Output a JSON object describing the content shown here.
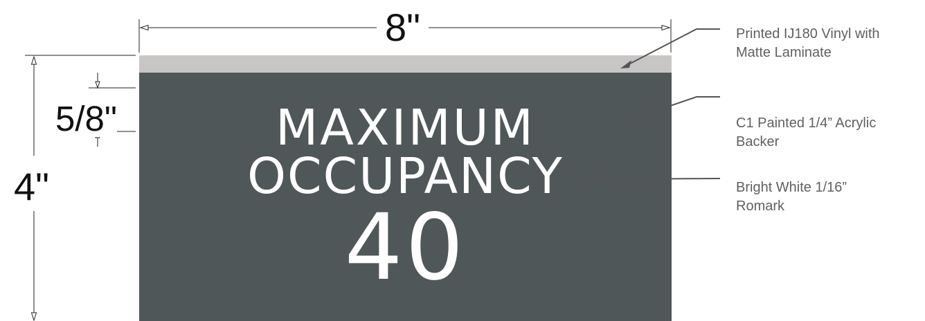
{
  "sign": {
    "line1": "MAXIMUM",
    "line2": "OCCUPANCY",
    "number": "40",
    "colors": {
      "face": "#505758",
      "cap": "#c8c6c5",
      "text": "#ffffff"
    }
  },
  "dimensions": {
    "width": "8\"",
    "height": "4\"",
    "letter_height": "5/8\""
  },
  "callouts": [
    {
      "lines": [
        "Printed IJ180 Vinyl with",
        "Matte Laminate"
      ]
    },
    {
      "lines": [
        "C1 Painted 1/4” Acrylic",
        "Backer"
      ]
    },
    {
      "lines": [
        "Bright White 1/16”",
        "Romark"
      ]
    }
  ]
}
